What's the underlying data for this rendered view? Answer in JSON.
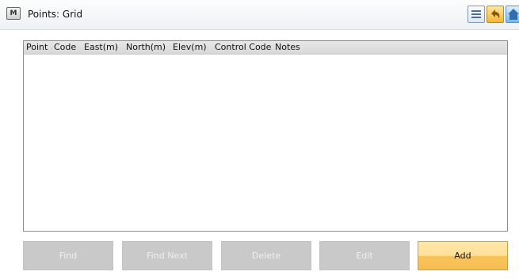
{
  "titlebar": {
    "app_icon": "M",
    "title": "Points: Grid",
    "icons": [
      "list-icon",
      "back-arrow-icon",
      "home-icon"
    ]
  },
  "grid": {
    "columns": [
      "Point",
      "Code",
      "East(m)",
      "North(m)",
      "Elev(m)",
      "Control Code",
      "Notes"
    ],
    "rows": []
  },
  "buttons": {
    "find": "Find",
    "find_next": "Find Next",
    "delete": "Delete",
    "edit": "Edit",
    "add": "Add"
  }
}
